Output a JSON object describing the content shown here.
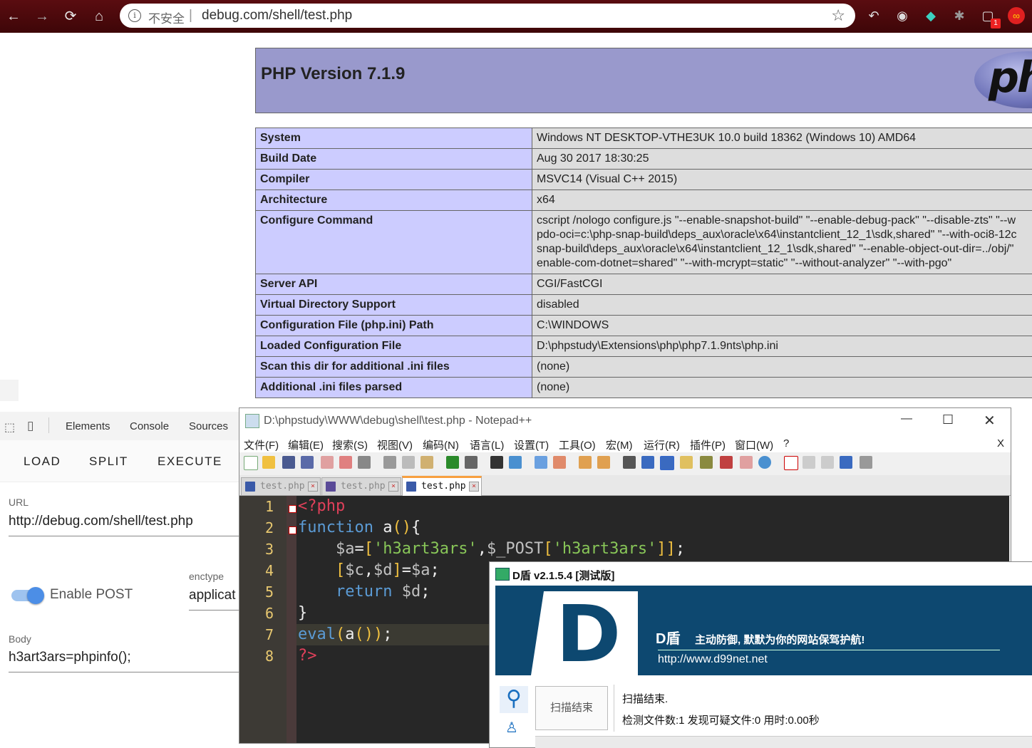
{
  "browser": {
    "insecure_label": "不安全",
    "url": "debug.com/shell/test.php",
    "badge_count": "1"
  },
  "php": {
    "title": "PHP Version 7.1.9",
    "logo_text": "php",
    "rows": [
      {
        "key": "System",
        "value": "Windows NT DESKTOP-VTHE3UK 10.0 build 18362 (Windows 10) AMD64"
      },
      {
        "key": "Build Date",
        "value": "Aug 30 2017 18:30:25"
      },
      {
        "key": "Compiler",
        "value": "MSVC14 (Visual C++ 2015)"
      },
      {
        "key": "Architecture",
        "value": "x64"
      },
      {
        "key": "Configure Command",
        "value": "cscript /nologo configure.js \"--enable-snapshot-build\" \"--enable-debug-pack\" \"--disable-zts\" \"--w\npdo-oci=c:\\php-snap-build\\deps_aux\\oracle\\x64\\instantclient_12_1\\sdk,shared\" \"--with-oci8-12c\nsnap-build\\deps_aux\\oracle\\x64\\instantclient_12_1\\sdk,shared\" \"--enable-object-out-dir=../obj/\"\nenable-com-dotnet=shared\" \"--with-mcrypt=static\" \"--without-analyzer\" \"--with-pgo\""
      },
      {
        "key": "Server API",
        "value": "CGI/FastCGI"
      },
      {
        "key": "Virtual Directory Support",
        "value": "disabled"
      },
      {
        "key": "Configuration File (php.ini) Path",
        "value": "C:\\WINDOWS"
      },
      {
        "key": "Loaded Configuration File",
        "value": "D:\\phpstudy\\Extensions\\php\\php7.1.9nts\\php.ini"
      },
      {
        "key": "Scan this dir for additional .ini files",
        "value": "(none)"
      },
      {
        "key": "Additional .ini files parsed",
        "value": "(none)"
      }
    ]
  },
  "devtools": {
    "tabs": [
      "Elements",
      "Console",
      "Sources"
    ],
    "hackbar_buttons": [
      "LOAD",
      "SPLIT",
      "EXECUTE"
    ],
    "url_label": "URL",
    "url_value": "http://debug.com/shell/test.php",
    "enable_post_label": "Enable POST",
    "enctype_label": "enctype",
    "enctype_value": "applicat",
    "body_label": "Body",
    "body_value": "h3art3ars=phpinfo();"
  },
  "notepad": {
    "title": "D:\\phpstudy\\WWW\\debug\\shell\\test.php - Notepad++",
    "menu": [
      "文件(F)",
      "编辑(E)",
      "搜索(S)",
      "视图(V)",
      "编码(N)",
      "语言(L)",
      "设置(T)",
      "工具(O)",
      "宏(M)",
      "运行(R)",
      "插件(P)",
      "窗口(W)",
      "?"
    ],
    "menu_close": "X",
    "tabs": [
      "test.php",
      "test.php",
      "test.php"
    ],
    "line_numbers": [
      "1",
      "2",
      "3",
      "4",
      "5",
      "6",
      "7",
      "8"
    ]
  },
  "dshield": {
    "title": "D盾 v2.1.5.4 [测试版]",
    "brand": "D盾",
    "slogan": "主动防御, 默默为你的网站保驾护航!",
    "url": "http://www.d99net.net",
    "scan_button": "扫描结束",
    "status": "扫描结束.",
    "stats": "检测文件数:1 发现可疑文件:0 用时:0.00秒"
  }
}
